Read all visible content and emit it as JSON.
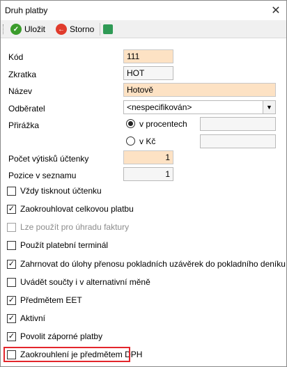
{
  "window": {
    "title": "Druh platby",
    "close_glyph": "✕"
  },
  "toolbar": {
    "save_label": "Uložit",
    "cancel_label": "Storno",
    "save_icon": "check-icon",
    "cancel_icon": "back-arrow-icon",
    "refresh_icon": "refresh-icon"
  },
  "form": {
    "kod_label": "Kód",
    "kod_value": "111",
    "zkratka_label": "Zkratka",
    "zkratka_value": "HOT",
    "nazev_label": "Název",
    "nazev_value": "Hotově",
    "odberatel_label": "Odběratel",
    "odberatel_value": "<nespecifikován>",
    "prirazka_label": "Přirážka",
    "radio_percent_label": "v procentech",
    "radio_kc_label": "v Kč",
    "percent_value": "",
    "kc_value": "",
    "pocet_label": "Počet výtisků účtenky",
    "pocet_value": "1",
    "pozice_label": "Pozice v seznamu",
    "pozice_value": "1"
  },
  "checkboxes": [
    {
      "label": "Vždy tisknout účtenku",
      "checked": false,
      "disabled": false
    },
    {
      "label": "Zaokrouhlovat celkovou platbu",
      "checked": true,
      "disabled": false
    },
    {
      "label": "Lze použít pro úhradu faktury",
      "checked": false,
      "disabled": true
    },
    {
      "label": "Použít platební terminál",
      "checked": false,
      "disabled": false
    },
    {
      "label": "Zahrnovat do úlohy přenosu pokladních uzávěrek do pokladního deníku",
      "checked": true,
      "disabled": false
    },
    {
      "label": "Uvádět součty i v alternativní měně",
      "checked": false,
      "disabled": false
    },
    {
      "label": "Předmětem EET",
      "checked": true,
      "disabled": false
    },
    {
      "label": "Aktivní",
      "checked": true,
      "disabled": false
    },
    {
      "label": "Povolit záporné platby",
      "checked": true,
      "disabled": false
    },
    {
      "label": "Zaokrouhlení je předmětem DPH",
      "checked": false,
      "disabled": false
    }
  ],
  "colors": {
    "required_field": "#fde2c4",
    "highlight": "#e3262c"
  }
}
